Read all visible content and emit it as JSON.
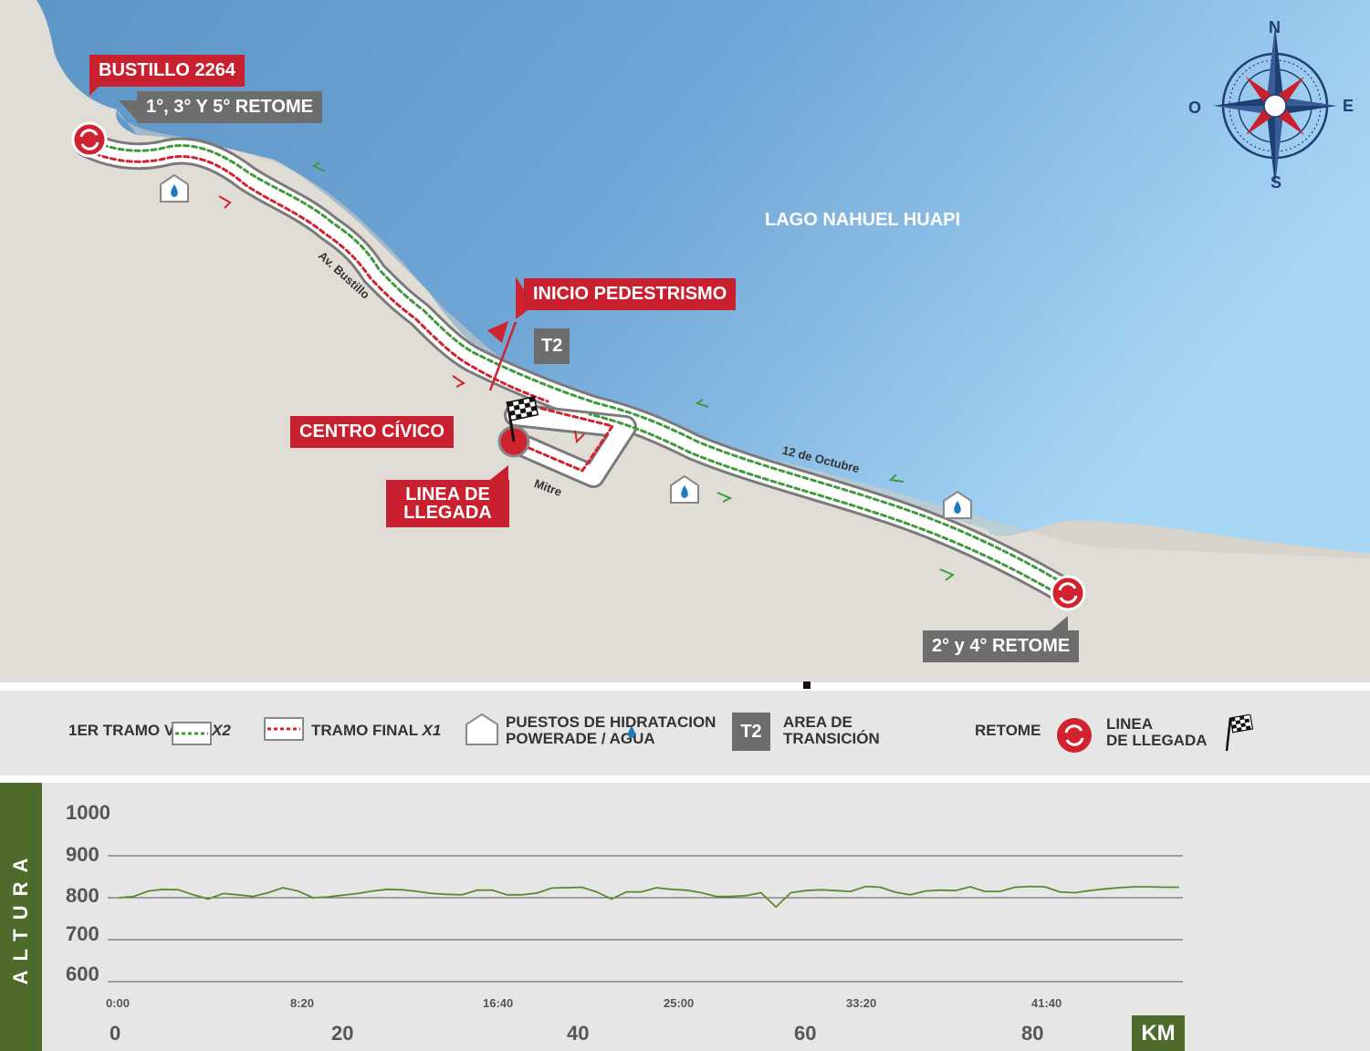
{
  "map": {
    "lake_label": "LAGO NAHUEL HUAPI",
    "compass": {
      "n": "N",
      "s": "S",
      "e": "E",
      "o": "O"
    },
    "labels": {
      "bustillo": "BUSTILLO 2264",
      "retome_1": "1°, 3° Y 5° RETOME",
      "inicio": "INICIO PEDESTRISMO",
      "t2": "T2",
      "centro": "CENTRO CÍVICO",
      "linea": "LINEA DE LLEGADA",
      "retome_2": "2° y 4° RETOME"
    },
    "streets": {
      "bustillo": "Av. Bustillo",
      "octubre": "12 de Octubre",
      "mitre": "Mitre"
    }
  },
  "legend": {
    "tramo_1_a": "1ER TRAMO VE",
    "tramo_1_b": "X2",
    "tramo_final_a": "TRAMO FINAL",
    "tramo_final_b": "X1",
    "hidratacion_1": "PUESTOS DE HIDRATACION",
    "hidratacion_2": "POWERADE / AGUA",
    "t2": "T2",
    "transicion_1": "AREA DE",
    "transicion_2": "TRANSICIÓN",
    "retome": "RETOME",
    "llegada_1": "LINEA",
    "llegada_2": "DE LLEGADA"
  },
  "chart_data": {
    "type": "line",
    "ylabel": "ALTURA",
    "xlabel": "KM",
    "ylim": [
      600,
      1000
    ],
    "y_ticks": [
      "1000",
      "900",
      "800",
      "700",
      "600"
    ],
    "time_ticks": [
      "0:00",
      "8:20",
      "16:40",
      "25:00",
      "33:20",
      "41:40"
    ],
    "km_ticks": [
      "0",
      "20",
      "40",
      "60",
      "80"
    ],
    "grid": true,
    "series": [
      {
        "color": "#5a8a2e",
        "points": [
          [
            0,
            800
          ],
          [
            1,
            803
          ],
          [
            2,
            816
          ],
          [
            3,
            820
          ],
          [
            4,
            819
          ],
          [
            5,
            807
          ],
          [
            6,
            797
          ],
          [
            7,
            810
          ],
          [
            8,
            807
          ],
          [
            9,
            803
          ],
          [
            10,
            812
          ],
          [
            11,
            824
          ],
          [
            12,
            816
          ],
          [
            13,
            800
          ],
          [
            14,
            802
          ],
          [
            15,
            806
          ],
          [
            16,
            810
          ],
          [
            17,
            816
          ],
          [
            18,
            820
          ],
          [
            19,
            819
          ],
          [
            20,
            815
          ],
          [
            21,
            810
          ],
          [
            22,
            808
          ],
          [
            23,
            807
          ],
          [
            24,
            818
          ],
          [
            25,
            818
          ],
          [
            26,
            807
          ],
          [
            27,
            807
          ],
          [
            28,
            811
          ],
          [
            29,
            823
          ],
          [
            30,
            824
          ],
          [
            31,
            825
          ],
          [
            32,
            814
          ],
          [
            33,
            797
          ],
          [
            34,
            814
          ],
          [
            35,
            814
          ],
          [
            36,
            824
          ],
          [
            37,
            820
          ],
          [
            38,
            818
          ],
          [
            39,
            812
          ],
          [
            40,
            803
          ],
          [
            41,
            803
          ],
          [
            42,
            805
          ],
          [
            43,
            812
          ],
          [
            44,
            778
          ],
          [
            45,
            812
          ],
          [
            46,
            817
          ],
          [
            47,
            819
          ],
          [
            48,
            817
          ],
          [
            49,
            815
          ],
          [
            50,
            827
          ],
          [
            51,
            825
          ],
          [
            52,
            813
          ],
          [
            53,
            807
          ],
          [
            54,
            816
          ],
          [
            55,
            818
          ],
          [
            56,
            817
          ],
          [
            57,
            826
          ],
          [
            58,
            815
          ],
          [
            59,
            815
          ],
          [
            60,
            825
          ],
          [
            61,
            827
          ],
          [
            62,
            826
          ],
          [
            63,
            814
          ],
          [
            64,
            812
          ],
          [
            65,
            817
          ],
          [
            66,
            821
          ],
          [
            67,
            824
          ],
          [
            68,
            826
          ],
          [
            69,
            826
          ],
          [
            70,
            825
          ],
          [
            71,
            825
          ]
        ]
      }
    ]
  }
}
